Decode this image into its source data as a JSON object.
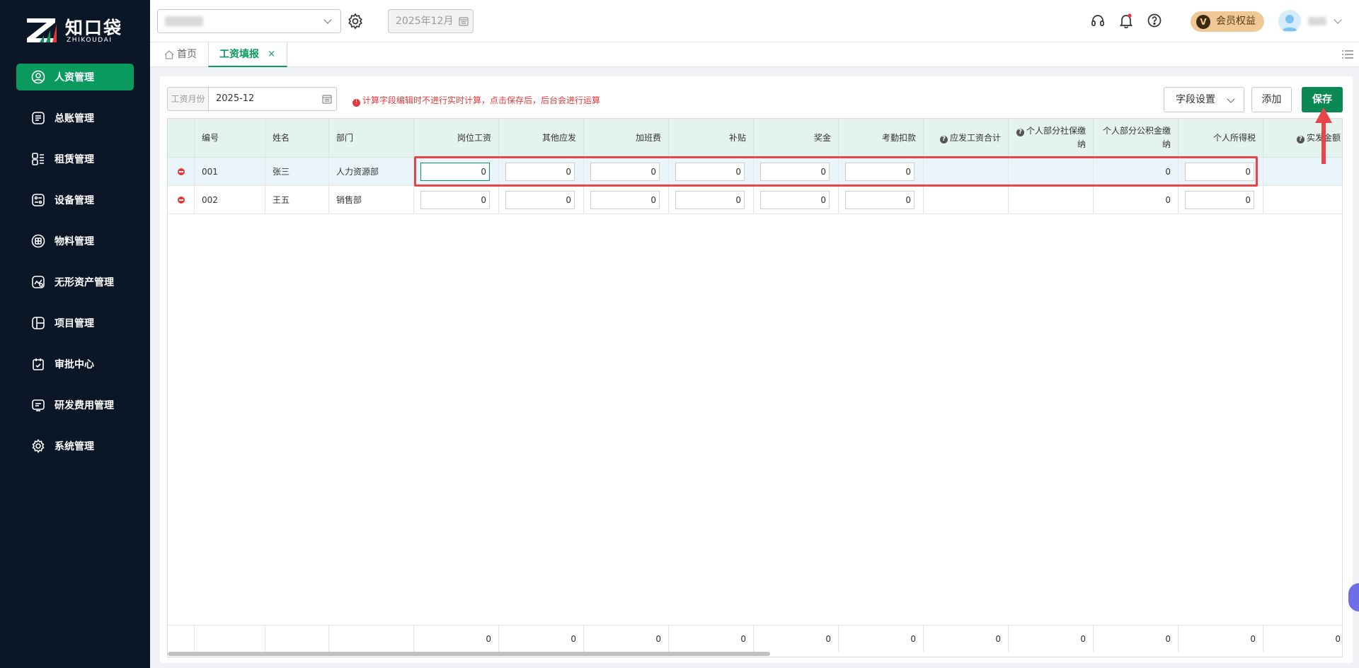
{
  "brand": {
    "name_cn": "知口袋",
    "name_en": "ZHIKOUDAI"
  },
  "sidebar": {
    "items": [
      {
        "label": "人资管理",
        "icon": "user-circle-icon",
        "active": true
      },
      {
        "label": "总账管理",
        "icon": "ledger-icon"
      },
      {
        "label": "租赁管理",
        "icon": "lease-icon"
      },
      {
        "label": "设备管理",
        "icon": "device-icon"
      },
      {
        "label": "物料管理",
        "icon": "material-icon"
      },
      {
        "label": "无形资产管理",
        "icon": "intangible-asset-icon"
      },
      {
        "label": "项目管理",
        "icon": "project-icon"
      },
      {
        "label": "审批中心",
        "icon": "approval-icon"
      },
      {
        "label": "研发费用管理",
        "icon": "rd-expense-icon"
      },
      {
        "label": "系统管理",
        "icon": "gear-icon"
      }
    ]
  },
  "topbar": {
    "period": "2025年12月",
    "member_label": "会员权益",
    "member_badge": "V"
  },
  "tabs": [
    {
      "label": "首页",
      "active": false
    },
    {
      "label": "工资填报",
      "active": true,
      "close": "×"
    }
  ],
  "toolbar": {
    "month_label": "工资月份",
    "month_value": "2025-12",
    "warning": "计算字段编辑时不进行实时计算，点击保存后，后台会进行运算",
    "warning_icon": "!",
    "field_settings": "字段设置",
    "add": "添加",
    "save": "保存"
  },
  "table": {
    "columns": [
      {
        "label": "编号"
      },
      {
        "label": "姓名"
      },
      {
        "label": "部门"
      },
      {
        "label": "岗位工资"
      },
      {
        "label": "其他应发"
      },
      {
        "label": "加班费"
      },
      {
        "label": "补贴"
      },
      {
        "label": "奖金"
      },
      {
        "label": "考勤扣款"
      },
      {
        "label": "应发工资合计",
        "help": "?"
      },
      {
        "label": "个人部分社保缴纳",
        "help": "?"
      },
      {
        "label": "个人部分公积金缴纳"
      },
      {
        "label": "个人所得税"
      },
      {
        "label": "实发金额",
        "help": "?"
      }
    ],
    "rows": [
      {
        "id": "001",
        "name": "张三",
        "dept": "人力资源部",
        "post_wage": "0",
        "other_pay": "0",
        "overtime": "0",
        "subsidy": "0",
        "bonus": "0",
        "attendance_deduction": "0",
        "gross_total": "",
        "social_security": "",
        "housing_fund": "0",
        "income_tax": "0",
        "net_pay": ""
      },
      {
        "id": "002",
        "name": "王五",
        "dept": "销售部",
        "post_wage": "0",
        "other_pay": "0",
        "overtime": "0",
        "subsidy": "0",
        "bonus": "0",
        "attendance_deduction": "0",
        "gross_total": "",
        "social_security": "",
        "housing_fund": "0",
        "income_tax": "0",
        "net_pay": ""
      }
    ],
    "totals": [
      "0",
      "0",
      "0",
      "0",
      "0",
      "0",
      "0",
      "0",
      "0",
      "0",
      "0"
    ]
  },
  "colors": {
    "accent": "#0a9a5d",
    "sidebar_bg": "#0b1626",
    "warning": "#e4393c",
    "highlight_box": "#e8444a",
    "header_bg": "#e5f3ee"
  }
}
